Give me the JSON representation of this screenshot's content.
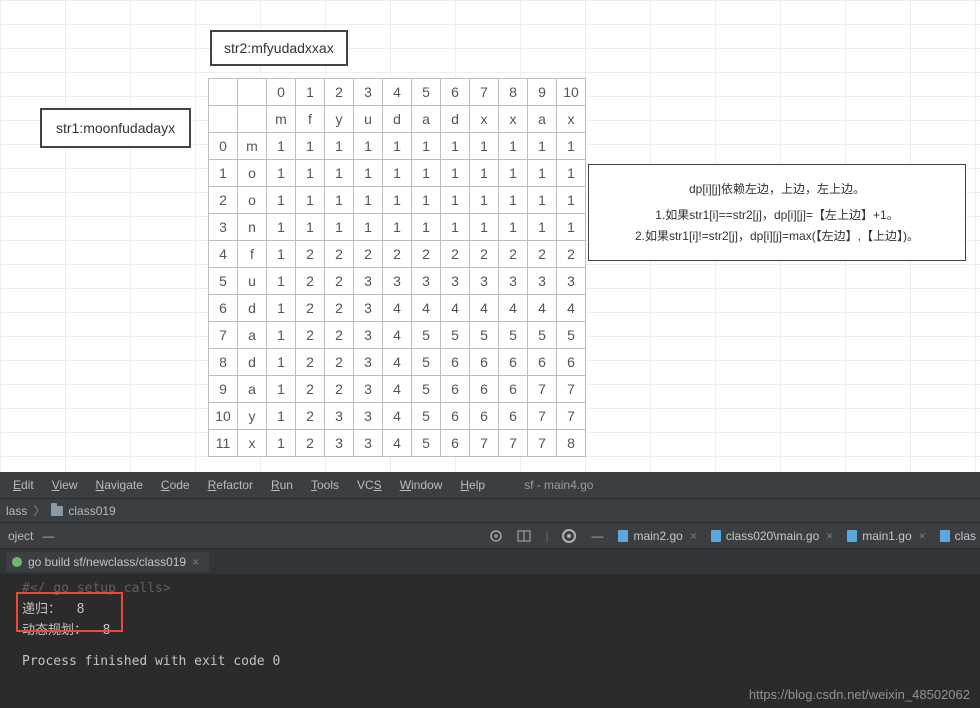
{
  "strings": {
    "str1_label": "str1:moonfudadayx",
    "str2_label": "str2:mfyudadxxax"
  },
  "explain": {
    "line1": "dp[i][j]依赖左边，上边，左上边。",
    "line2": "1.如果str1[i]==str2[j]，dp[i][j]=【左上边】+1。",
    "line3": "2.如果str1[i]!=str2[j]，dp[i][j]=max(【左边】,【上边】)。"
  },
  "chart_data": {
    "type": "table",
    "title": "LCS dp table for str1=moonfudadayx, str2=mfyudadxxax",
    "col_indices": [
      "0",
      "1",
      "2",
      "3",
      "4",
      "5",
      "6",
      "7",
      "8",
      "9",
      "10"
    ],
    "col_chars": [
      "m",
      "f",
      "y",
      "u",
      "d",
      "a",
      "d",
      "x",
      "x",
      "a",
      "x"
    ],
    "row_indices": [
      "0",
      "1",
      "2",
      "3",
      "4",
      "5",
      "6",
      "7",
      "8",
      "9",
      "10",
      "11"
    ],
    "row_chars": [
      "m",
      "o",
      "o",
      "n",
      "f",
      "u",
      "d",
      "a",
      "d",
      "a",
      "y",
      "x"
    ],
    "values": [
      [
        "1",
        "1",
        "1",
        "1",
        "1",
        "1",
        "1",
        "1",
        "1",
        "1",
        "1"
      ],
      [
        "1",
        "1",
        "1",
        "1",
        "1",
        "1",
        "1",
        "1",
        "1",
        "1",
        "1"
      ],
      [
        "1",
        "1",
        "1",
        "1",
        "1",
        "1",
        "1",
        "1",
        "1",
        "1",
        "1"
      ],
      [
        "1",
        "1",
        "1",
        "1",
        "1",
        "1",
        "1",
        "1",
        "1",
        "1",
        "1"
      ],
      [
        "1",
        "2",
        "2",
        "2",
        "2",
        "2",
        "2",
        "2",
        "2",
        "2",
        "2"
      ],
      [
        "1",
        "2",
        "2",
        "3",
        "3",
        "3",
        "3",
        "3",
        "3",
        "3",
        "3"
      ],
      [
        "1",
        "2",
        "2",
        "3",
        "4",
        "4",
        "4",
        "4",
        "4",
        "4",
        "4"
      ],
      [
        "1",
        "2",
        "2",
        "3",
        "4",
        "5",
        "5",
        "5",
        "5",
        "5",
        "5"
      ],
      [
        "1",
        "2",
        "2",
        "3",
        "4",
        "5",
        "6",
        "6",
        "6",
        "6",
        "6"
      ],
      [
        "1",
        "2",
        "2",
        "3",
        "4",
        "5",
        "6",
        "6",
        "6",
        "7",
        "7"
      ],
      [
        "1",
        "2",
        "3",
        "3",
        "4",
        "5",
        "6",
        "6",
        "6",
        "7",
        "7"
      ],
      [
        "1",
        "2",
        "3",
        "3",
        "4",
        "5",
        "6",
        "7",
        "7",
        "7",
        "8"
      ]
    ]
  },
  "ide": {
    "menus": [
      "Edit",
      "View",
      "Navigate",
      "Code",
      "Refactor",
      "Run",
      "Tools",
      "VCS",
      "Window",
      "Help"
    ],
    "context": "sf - main4.go",
    "crumb_first": "lass",
    "crumb_second": "class019",
    "project_label": "oject",
    "open_tabs": [
      "main2.go",
      "class020\\main.go",
      "main1.go",
      "clas"
    ],
    "build_tab": "go build sf/newclass/class019",
    "console_lines": {
      "setup": "#</ go setup calls>",
      "out1": "递归：  8",
      "out2": "动态规划：  8",
      "exit": "Process finished with exit code 0"
    },
    "watermark": "https://blog.csdn.net/weixin_48502062"
  }
}
